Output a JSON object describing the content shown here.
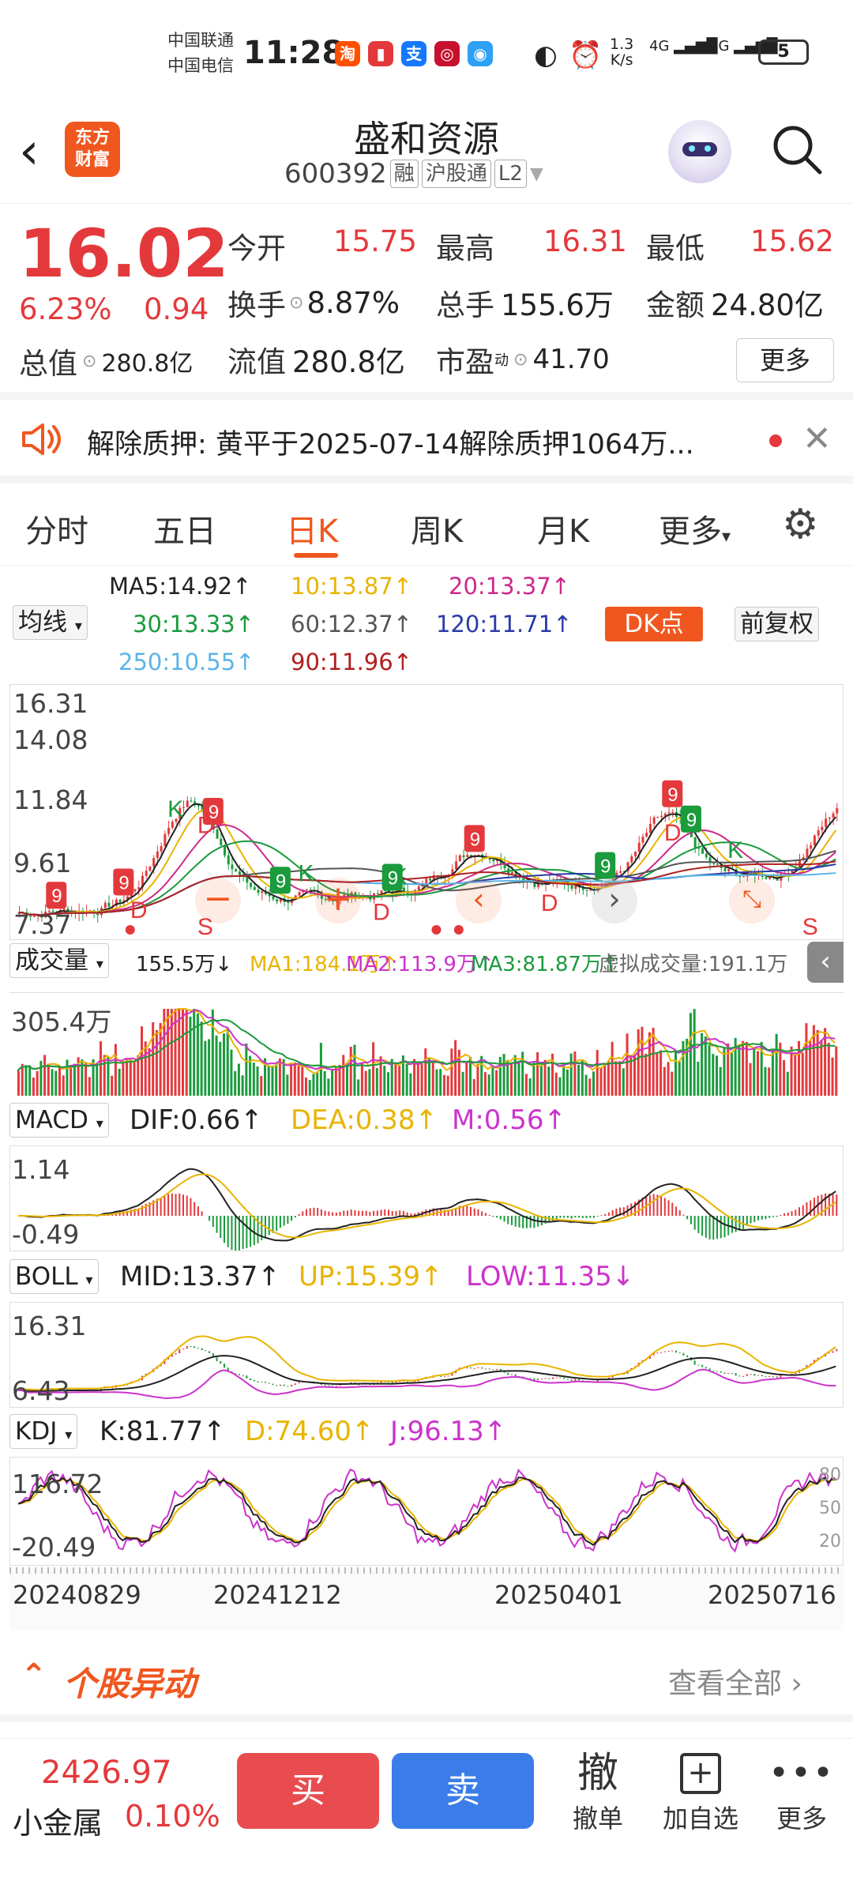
{
  "status": {
    "carrier1": "中国联通",
    "carrier2": "中国电信",
    "time": "11:28",
    "net_speed_top": "1.3",
    "net_speed_bottom": "K/s",
    "sig1": "4G",
    "sig2": "4G",
    "battery": "5"
  },
  "header": {
    "logo": "东方\n财富",
    "title": "盛和资源",
    "code": "600392",
    "tag_rong": "融",
    "tag_hgt": "沪股通",
    "tag_l2": "L2"
  },
  "quote": {
    "price": "16.02",
    "pct": "6.23%",
    "chg": "0.94",
    "open_label": "今开",
    "open": "15.75",
    "high_label": "最高",
    "high": "16.31",
    "low_label": "最低",
    "low": "15.62",
    "turnover_label": "换手",
    "turnover": "8.87%",
    "volume_label": "总手",
    "volume": "155.6万",
    "amount_label": "金额",
    "amount": "24.80亿",
    "mcap_label": "总值",
    "mcap": "280.8亿",
    "float_label": "流值",
    "float": "280.8亿",
    "pe_label": "市盈",
    "pe_sup": "动",
    "pe": "41.70",
    "more": "更多"
  },
  "notice": {
    "label": "解除质押:",
    "text": "黄平于2025-07-14解除质押1064万..."
  },
  "tabs": [
    "分时",
    "五日",
    "日K",
    "周K",
    "月K",
    "更多"
  ],
  "active_tab": 2,
  "ma": {
    "select": "均线",
    "ma5": "MA5:14.92↑",
    "ma10": "10:13.87↑",
    "ma20": "20:13.37↑",
    "ma30": "30:13.33↑",
    "ma60": "60:12.37↑",
    "ma120": "120:11.71↑",
    "ma250": "250:10.55↑",
    "ma90": "90:11.96↑",
    "dk": "DK点",
    "adjust": "前复权"
  },
  "kline_axis": [
    "16.31",
    "14.08",
    "11.84",
    "9.61",
    "7.37"
  ],
  "volume": {
    "select": "成交量",
    "vol": "155.5万↓",
    "ma1": "MA1:184.1万↑",
    "ma2": "MA2:113.9万↑",
    "ma3": "MA3:81.87万↑",
    "virtual": "虚拟成交量:191.1万",
    "axis_top": "305.4万"
  },
  "macd": {
    "select": "MACD",
    "dif": "DIF:0.66↑",
    "dea": "DEA:0.38↑",
    "m": "M:0.56↑",
    "axis_top": "1.14",
    "axis_bottom": "-0.49"
  },
  "boll": {
    "select": "BOLL",
    "mid": "MID:13.37↑",
    "up": "UP:15.39↑",
    "low": "LOW:11.35↓",
    "axis_top": "16.31",
    "axis_bottom": "6.43"
  },
  "kdj": {
    "select": "KDJ",
    "k": "K:81.77↑",
    "d": "D:74.60↑",
    "j": "J:96.13↑",
    "axis_top": "116.72",
    "axis_bottom": "-20.49",
    "right_top": "80",
    "right_mid": "50",
    "right_bottom": "20"
  },
  "dates": [
    "20240829",
    "20241212",
    "20250401",
    "20250716"
  ],
  "section": {
    "title": "个股异动",
    "view_all": "查看全部"
  },
  "bottom": {
    "index_value": "2426.97",
    "index_name": "小金属",
    "index_pct": "0.10%",
    "buy": "买",
    "sell": "卖",
    "cancel_icon": "撤",
    "cancel": "撤单",
    "add": "加自选",
    "more": "更多"
  },
  "colors": {
    "red": "#e4393c",
    "green": "#1a9b3c",
    "orange": "#f0571f",
    "blue": "#3a7de8",
    "yellow": "#e8b400",
    "magenta": "#cc33cc"
  }
}
